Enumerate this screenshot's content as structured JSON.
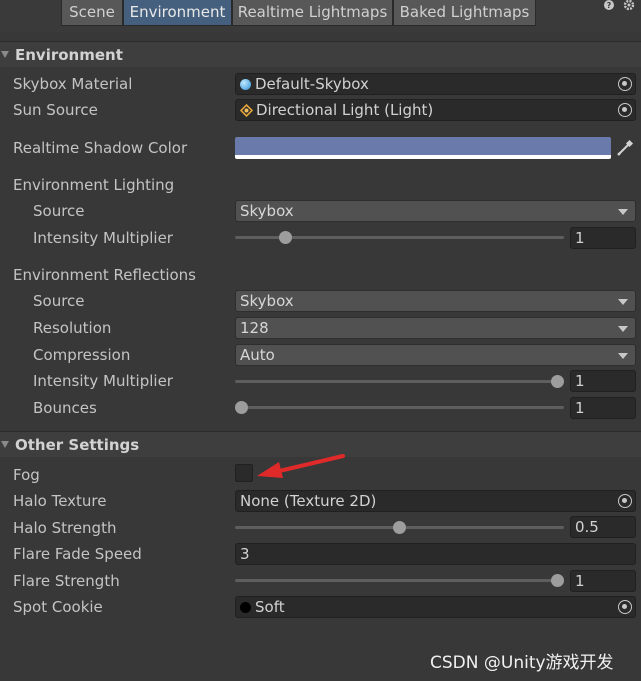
{
  "tabs": [
    {
      "label": "Scene",
      "active": false
    },
    {
      "label": "Environment",
      "active": true
    },
    {
      "label": "Realtime Lightmaps",
      "active": false
    },
    {
      "label": "Baked Lightmaps",
      "active": false
    }
  ],
  "top_icons": [
    "help-icon",
    "settings-icon"
  ],
  "environment": {
    "header": "Environment",
    "skybox_material": {
      "label": "Skybox Material",
      "value": "Default-Skybox"
    },
    "sun_source": {
      "label": "Sun Source",
      "value": "Directional Light (Light)"
    },
    "realtime_shadow_color": {
      "label": "Realtime Shadow Color",
      "color": "#6a7aab"
    },
    "lighting": {
      "label": "Environment Lighting",
      "source": {
        "label": "Source",
        "value": "Skybox"
      },
      "intensity": {
        "label": "Intensity Multiplier",
        "value": "1",
        "fraction": 0.14
      }
    },
    "reflections": {
      "label": "Environment Reflections",
      "source": {
        "label": "Source",
        "value": "Skybox"
      },
      "resolution": {
        "label": "Resolution",
        "value": "128"
      },
      "compression": {
        "label": "Compression",
        "value": "Auto"
      },
      "intensity": {
        "label": "Intensity Multiplier",
        "value": "1",
        "fraction": 1.0
      },
      "bounces": {
        "label": "Bounces",
        "value": "1",
        "fraction": 0.0
      }
    }
  },
  "other": {
    "header": "Other Settings",
    "fog": {
      "label": "Fog",
      "checked": false
    },
    "halo_texture": {
      "label": "Halo Texture",
      "value": "None (Texture 2D)"
    },
    "halo_strength": {
      "label": "Halo Strength",
      "value": "0.5",
      "fraction": 0.5
    },
    "flare_fade_speed": {
      "label": "Flare Fade Speed",
      "value": "3"
    },
    "flare_strength": {
      "label": "Flare Strength",
      "value": "1",
      "fraction": 1.0
    },
    "spot_cookie": {
      "label": "Spot Cookie",
      "value": "Soft"
    }
  },
  "watermark": "CSDN @Unity游戏开发",
  "colors": {
    "panel": "#383838",
    "active_tab": "#45607e",
    "annotation_arrow": "#e02a2a"
  }
}
